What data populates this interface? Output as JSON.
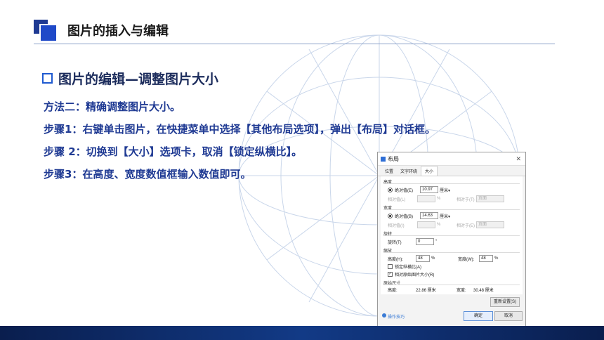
{
  "header": {
    "title": "图片的插入与编辑"
  },
  "section": {
    "title": "图片的编辑—调整图片大小"
  },
  "paragraphs": [
    "方法二：精确调整图片大小。",
    "步骤1：右键单击图片，在快捷菜单中选择【其他布局选项】，弹出【布局】对话框。",
    "步骤 2：切换到【大小】选项卡，取消【锁定纵横比】。",
    "步骤3：在高度、宽度数值框输入数值即可。"
  ],
  "dialog": {
    "title": "布局",
    "close": "✕",
    "tabs": [
      "位置",
      "文字环绕",
      "大小"
    ],
    "height_group": "高度",
    "height_abs_label": "绝对值(E)",
    "height_abs_value": "10.97",
    "height_abs_unit": "厘米▾",
    "height_rel_label": "相对值(L)",
    "height_rel_unit": "%",
    "height_rel_to_label": "相对于(T)",
    "height_rel_to_value": "页面",
    "width_group": "宽度",
    "width_abs_label": "绝对值(B)",
    "width_abs_value": "14.63",
    "width_abs_unit": "厘米▾",
    "width_rel_label": "相对值(I)",
    "width_rel_unit": "%",
    "width_rel_to_label": "相对于(E)",
    "width_rel_to_value": "页面",
    "rotate_group": "旋转",
    "rotate_label": "旋转(T)",
    "rotate_value": "0",
    "rotate_unit": "°",
    "scale_group": "缩放",
    "scale_h_label": "高度(H):",
    "scale_h_value": "48",
    "scale_h_unit": "%",
    "scale_w_label": "宽度(W):",
    "scale_w_value": "48",
    "scale_w_unit": "%",
    "lock_ratio": "锁定纵横比(A)",
    "relative_original": "相对原始图片大小(R)",
    "original_group": "原始尺寸",
    "orig_h_label": "高度:",
    "orig_h_value": "22.86 厘米",
    "orig_w_label": "宽度:",
    "orig_w_value": "30.48 厘米",
    "reset_button": "重新设置(S)",
    "tips": "操作技巧",
    "ok": "确定",
    "cancel": "取消"
  },
  "colors": {
    "accent": "#1f3a93",
    "bullet": "#1f5ad0",
    "bottom_bar": "#0a1e4e"
  }
}
